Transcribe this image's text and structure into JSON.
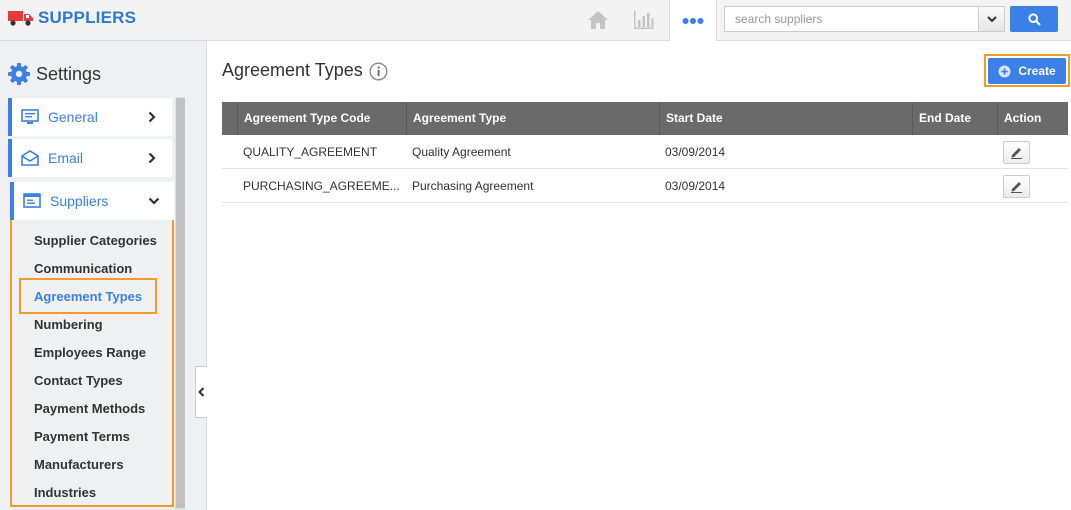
{
  "header": {
    "app_name": "SUPPLIERS",
    "nav_icons": [
      "home-icon",
      "bar-chart-icon",
      "more-icon"
    ],
    "search": {
      "placeholder": "search suppliers",
      "value": ""
    },
    "accent": "#3a80e6",
    "brand_color": "#2e7ad1"
  },
  "sidebar": {
    "title": "Settings",
    "items": [
      {
        "label": "General",
        "icon": "monitor-icon",
        "expanded": false
      },
      {
        "label": "Email",
        "icon": "envelope-icon",
        "expanded": false
      },
      {
        "label": "Suppliers",
        "icon": "list-icon",
        "expanded": true
      }
    ],
    "sub_items": [
      "Supplier Categories",
      "Communication",
      "Agreement Types",
      "Numbering",
      "Employees Range",
      "Contact Types",
      "Payment Methods",
      "Payment Terms",
      "Manufacturers",
      "Industries"
    ],
    "active_sub_item": "Agreement Types",
    "highlight_color": "#f39a2d"
  },
  "main": {
    "title": "Agreement Types",
    "create_label": "Create",
    "table": {
      "columns": [
        "Agreement Type Code",
        "Agreement Type",
        "Start Date",
        "End Date",
        "Action"
      ],
      "rows": [
        {
          "code": "QUALITY_AGREEMENT",
          "type": "Quality Agreement",
          "start": "03/09/2014",
          "end": ""
        },
        {
          "code": "PURCHASING_AGREEME...",
          "type": "Purchasing Agreement",
          "start": "03/09/2014",
          "end": ""
        }
      ]
    }
  }
}
